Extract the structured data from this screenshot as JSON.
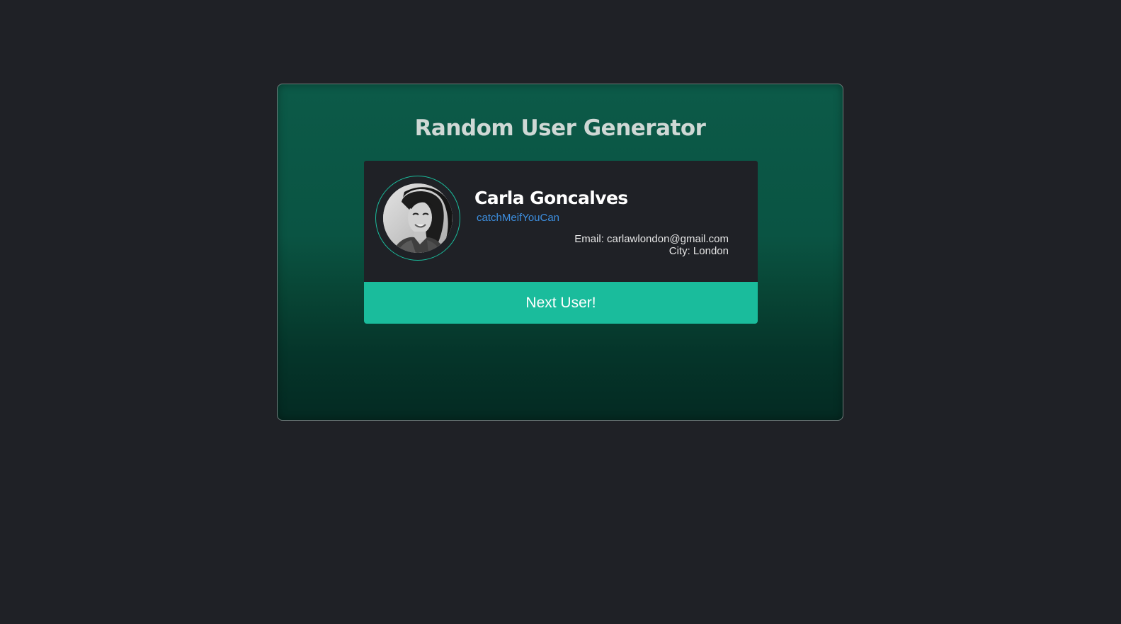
{
  "page": {
    "title": "Random User Generator"
  },
  "user": {
    "name": "Carla Goncalves",
    "username": "catchMeifYouCan",
    "email_line": "Email: carlawlondon@gmail.com",
    "city_line": "City: London",
    "avatar_icon": "user-photo"
  },
  "actions": {
    "next_label": "Next User!"
  },
  "colors": {
    "background": "#1f2126",
    "card_gradient_top": "#0c5a48",
    "card_gradient_bottom": "#042a22",
    "accent": "#1abc9c",
    "username_link": "#3d8fe0"
  }
}
